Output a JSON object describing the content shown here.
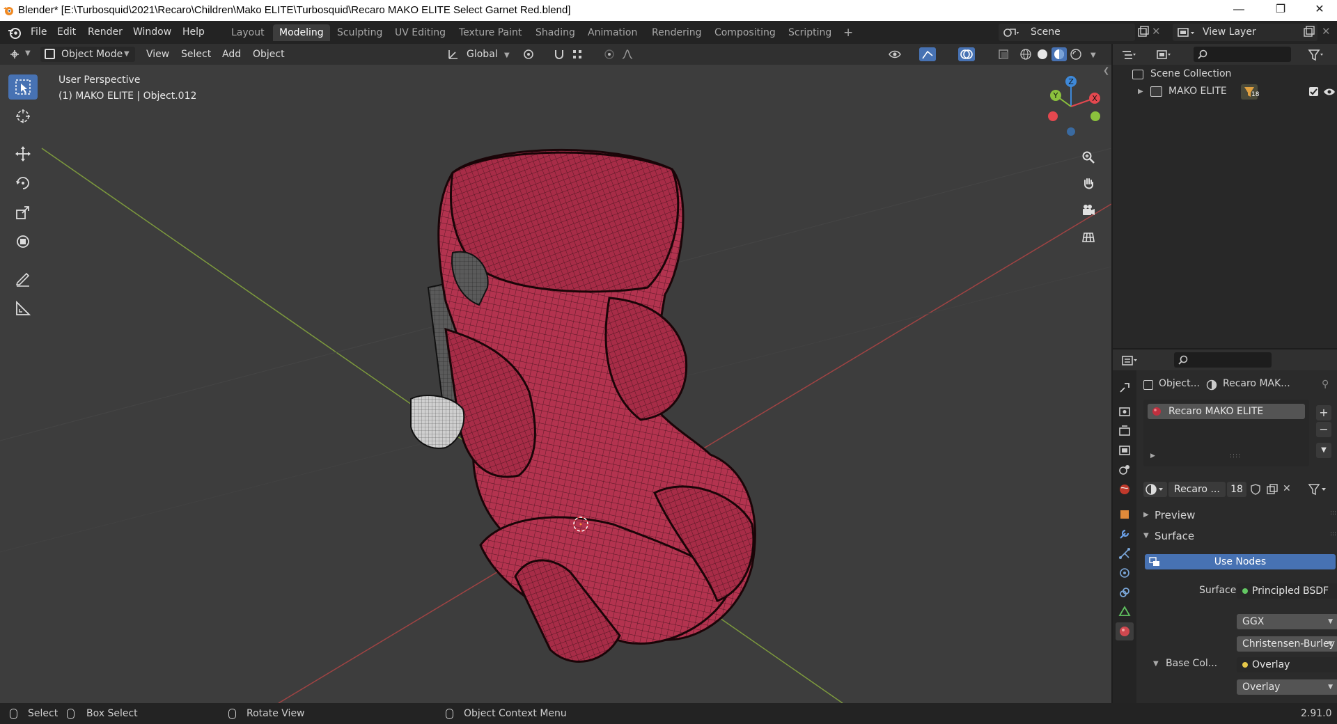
{
  "window": {
    "title": "Blender* [E:\\Turbosquid\\2021\\Recaro\\Children\\Mako ELITE\\Turbosquid\\Recaro MAKO ELITE Select Garnet Red.blend]"
  },
  "menu": {
    "items": [
      "File",
      "Edit",
      "Render",
      "Window",
      "Help"
    ]
  },
  "workspaces": {
    "tabs": [
      "Layout",
      "Modeling",
      "Sculpting",
      "UV Editing",
      "Texture Paint",
      "Shading",
      "Animation",
      "Rendering",
      "Compositing",
      "Scripting"
    ],
    "active": "Modeling",
    "add": "+"
  },
  "scene": {
    "name": "Scene",
    "view_layer": "View Layer"
  },
  "header3d": {
    "mode": "Object Mode",
    "menus": [
      "View",
      "Select",
      "Add",
      "Object"
    ],
    "orientation": "Global"
  },
  "viewport": {
    "perspective": "User Perspective",
    "object_info": "(1) MAKO ELITE | Object.012",
    "gizmo": {
      "x": "X",
      "y": "Y",
      "z": "Z"
    }
  },
  "outliner": {
    "root": "Scene Collection",
    "items": [
      {
        "name": "MAKO ELITE",
        "badge": "18"
      }
    ]
  },
  "properties": {
    "tab_object": "Object...",
    "tab_material": "Recaro MAK...",
    "material_slot": "Recaro MAKO ELITE",
    "material_name": "Recaro ...",
    "users": "18",
    "panel_preview": "Preview",
    "panel_surface": "Surface",
    "use_nodes": "Use Nodes",
    "surface_label": "Surface",
    "surface_value": "Principled BSDF",
    "distribution": "GGX",
    "subsurface_method": "Christensen-Burley",
    "base_color_label": "Base Col...",
    "base_color_value": "Overlay",
    "blend_type": "Overlay"
  },
  "status": {
    "select": "Select",
    "box_select": "Box Select",
    "rotate": "Rotate View",
    "context": "Object Context Menu",
    "version": "2.91.0"
  },
  "colors": {
    "accent": "#4772b3",
    "seat": "#b3334f",
    "x_axis": "#e4484f",
    "y_axis": "#8bc13d",
    "z_axis": "#3e89d9"
  }
}
